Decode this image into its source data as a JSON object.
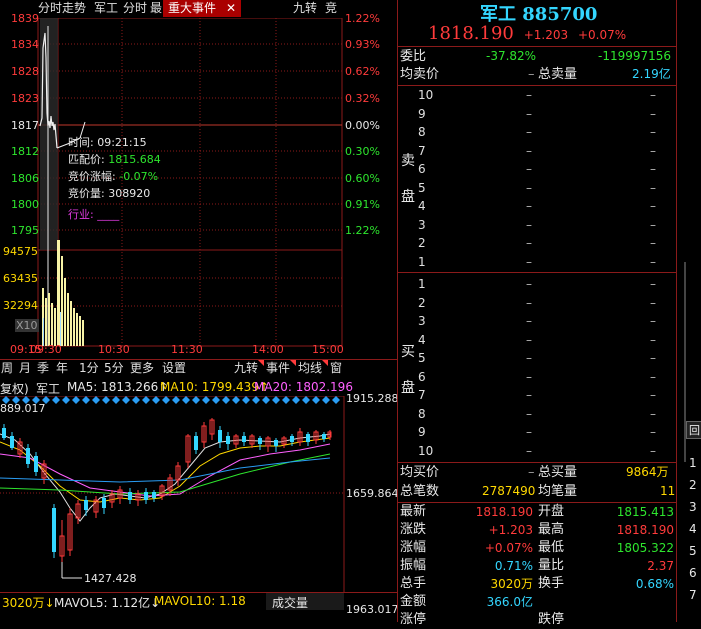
{
  "top_tabs": {
    "intraday": "分时走势",
    "name": "军工",
    "intraday2": "分时",
    "tab_cut": "最",
    "events": "重大事件",
    "close_glyph": "✕",
    "jiuzhuan": "九转",
    "jing": "竞"
  },
  "intraday_chart": {
    "left_axis": [
      "1839",
      "1834",
      "1828",
      "1823",
      "1817",
      "1812",
      "1806",
      "1800",
      "1795"
    ],
    "right_axis": [
      "1.22%",
      "0.93%",
      "0.62%",
      "0.32%",
      "0.00%",
      "0.30%",
      "0.60%",
      "0.91%",
      "1.22%"
    ],
    "volume_axis": [
      "94575",
      "63435",
      "32294",
      "X10"
    ],
    "time_axis": [
      "09:15",
      "09:30",
      "10:30",
      "11:30",
      "14:00",
      "15:00"
    ],
    "tooltip": {
      "time_label": "时间:",
      "time_value": "09:21:15",
      "match_label": "匹配价:",
      "match_value": "1815.684",
      "change_label": "竞价涨幅:",
      "change_value": "-0.07%",
      "volume_label": "竞价量:",
      "volume_value": "308920",
      "industry_label": "行业:",
      "industry_value": "____"
    }
  },
  "kline_toolbar": {
    "items": [
      "周",
      "月",
      "季",
      "年",
      "1分",
      "5分",
      "更多",
      "设置"
    ],
    "right_items": [
      "九转",
      "事件",
      "均线",
      "窗"
    ]
  },
  "kline_header": {
    "prefix": "复权)",
    "name": "军工",
    "ma5": "MA5: 1813.266↑",
    "ma10": "MA10: 1799.439↑",
    "ma20": "MA20: 1802.196"
  },
  "kline_chart": {
    "top_label": "889.017",
    "right_top": "1915.288",
    "right_mid": "1659.864",
    "low_label": "1427.428",
    "right_bottom": "1963.017"
  },
  "volume_bar": {
    "vol": "3020万↓",
    "mavol5": "MAVOL5: 1.12亿↓",
    "mavol10": "MAVOL10: 1.18",
    "selector": "成交量"
  },
  "quote": {
    "name": "军工",
    "code": "885700",
    "price": "1818.190",
    "change": "+1.203",
    "change_pct": "+0.07%",
    "weibi_label": "委比",
    "weibi_pct": "-37.82%",
    "weibi_value": "-119997156",
    "avg_sell_label": "均卖价",
    "avg_sell_dash": "–",
    "total_sell_label": "总卖量",
    "total_sell_value": "2.19亿",
    "sell_side_label_1": "卖",
    "sell_side_label_2": "盘",
    "buy_side_label_1": "买",
    "buy_side_label_2": "盘",
    "sell_levels": [
      "10",
      "9",
      "8",
      "7",
      "6",
      "5",
      "4",
      "3",
      "2",
      "1"
    ],
    "buy_levels": [
      "1",
      "2",
      "3",
      "4",
      "5",
      "6",
      "7",
      "8",
      "9",
      "10"
    ],
    "level_dash": "–",
    "avg_buy_label": "均买价",
    "avg_buy_dash": "–",
    "total_buy_label": "总买量",
    "total_buy_value": "9864万",
    "total_trades_label": "总笔数",
    "total_trades_value": "2787490",
    "avg_trade_label": "均笔量",
    "avg_trade_value": "11",
    "stats": [
      {
        "l1": "最新",
        "v1": "1818.190",
        "c1": "red",
        "l2": "开盘",
        "v2": "1815.413",
        "c2": "green"
      },
      {
        "l1": "涨跌",
        "v1": "+1.203",
        "c1": "red",
        "l2": "最高",
        "v2": "1818.190",
        "c2": "red"
      },
      {
        "l1": "涨幅",
        "v1": "+0.07%",
        "c1": "red",
        "l2": "最低",
        "v2": "1805.322",
        "c2": "green"
      },
      {
        "l1": "振幅",
        "v1": "0.71%",
        "c1": "cyan",
        "l2": "量比",
        "v2": "2.37",
        "c2": "red"
      },
      {
        "l1": "总手",
        "v1": "3020万",
        "c1": "yellow",
        "l2": "换手",
        "v2": "0.68%",
        "c2": "cyan"
      },
      {
        "l1": "金额",
        "v1": "366.0亿",
        "c1": "cyan",
        "l2": "",
        "v2": "",
        "c2": "cyan"
      },
      {
        "l1": "涨停",
        "v1": "",
        "c1": "red",
        "l2": "跌停",
        "v2": "",
        "c2": "green"
      }
    ]
  },
  "side_tabs": [
    "回",
    "1",
    "2",
    "3",
    "4",
    "5",
    "6",
    "7"
  ],
  "colors": {
    "accent_red": "#ff3b3b",
    "accent_green": "#2ee52e",
    "grid_red": "#8b1a1a",
    "cyan": "#34d6ff",
    "yellow": "#ffd800"
  }
}
